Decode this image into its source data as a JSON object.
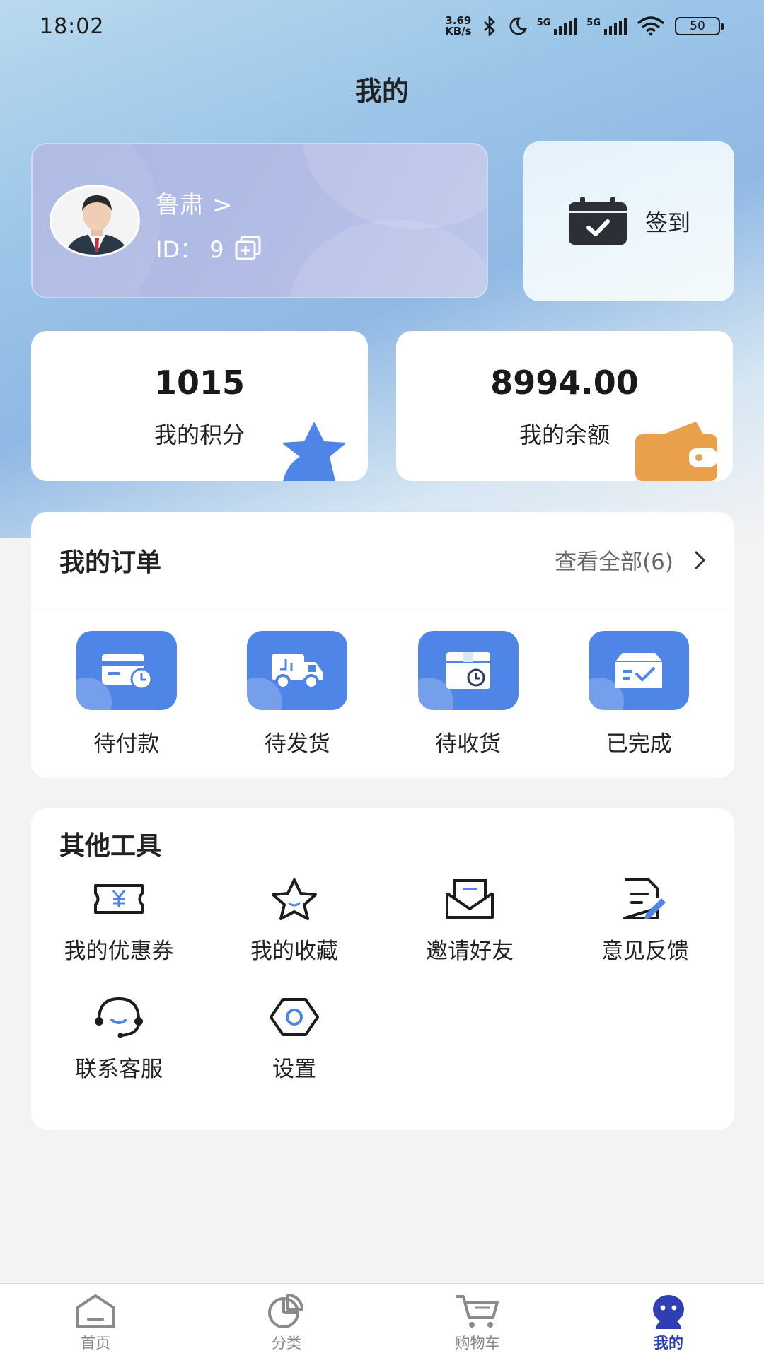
{
  "status_bar": {
    "time": "18:02",
    "net_speed_value": "3.69",
    "net_speed_unit": "KB/s",
    "sim1_label": "5G",
    "sim2_label": "5G",
    "battery": "50"
  },
  "header": {
    "title": "我的"
  },
  "profile": {
    "name": "鲁肃",
    "name_chevron": ">",
    "id_label": "ID：",
    "id_value": "9"
  },
  "checkin": {
    "label": "签到"
  },
  "stats": {
    "points_value": "1015",
    "points_label": "我的积分",
    "balance_value": "8994.00",
    "balance_label": "我的余额"
  },
  "orders": {
    "title": "我的订单",
    "view_all": "查看全部(6)",
    "items": [
      {
        "label": "待付款",
        "icon": "payment-card-icon"
      },
      {
        "label": "待发货",
        "icon": "delivery-truck-icon"
      },
      {
        "label": "待收货",
        "icon": "package-clock-icon"
      },
      {
        "label": "已完成",
        "icon": "completed-check-icon"
      }
    ]
  },
  "tools": {
    "title": "其他工具",
    "items": [
      {
        "label": "我的优惠券",
        "icon": "coupon-icon"
      },
      {
        "label": "我的收藏",
        "icon": "star-icon"
      },
      {
        "label": "邀请好友",
        "icon": "envelope-icon"
      },
      {
        "label": "意见反馈",
        "icon": "feedback-edit-icon"
      },
      {
        "label": "联系客服",
        "icon": "headset-icon"
      },
      {
        "label": "设置",
        "icon": "settings-hex-icon"
      }
    ]
  },
  "tabbar": {
    "items": [
      {
        "label": "首页",
        "icon": "home-icon"
      },
      {
        "label": "分类",
        "icon": "category-pie-icon"
      },
      {
        "label": "购物车",
        "icon": "cart-icon"
      },
      {
        "label": "我的",
        "icon": "profile-icon"
      }
    ],
    "active_index": 3
  },
  "colors": {
    "accent_blue": "#4f85e6",
    "wallet_orange": "#e9a04b",
    "tab_active": "#2f3fb3"
  }
}
